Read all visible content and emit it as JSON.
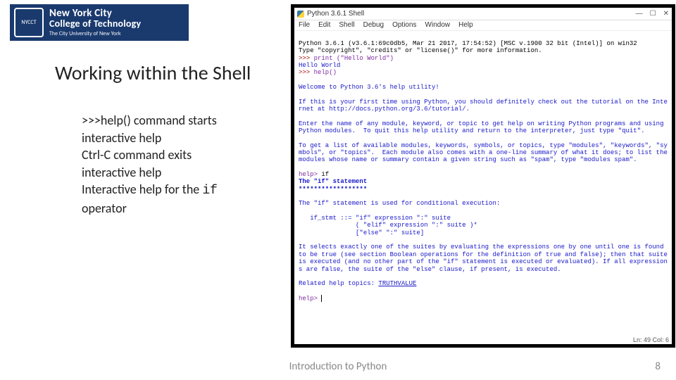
{
  "logo": {
    "line1": "New York City",
    "line2": "College of Technology",
    "line3": "The City University of New York",
    "seal": "NYCCT"
  },
  "slide_title": "Working within the Shell",
  "bullets": {
    "b1a": ">>>help() command starts",
    "b1b": "interactive help",
    "b2a": "Ctrl-C command exits",
    "b2b": "interactive help",
    "b3a": "Interactive help for the ",
    "b3code": "if",
    "b3b": "operator"
  },
  "shell": {
    "title": "Python 3.6.1 Shell",
    "win_min": "—",
    "win_max": "☐",
    "win_close": "✕",
    "menu": [
      "File",
      "Edit",
      "Shell",
      "Debug",
      "Options",
      "Window",
      "Help"
    ],
    "banner1": "Python 3.6.1 (v3.6.1:69c0db5, Mar 21 2017, 17:54:52) [MSC v.1900 32 bit (Intel)] on win32",
    "banner2": "Type \"copyright\", \"credits\" or \"license()\" for more information.",
    "prompt": ">>> ",
    "line_print": "print (\"Hello World\")",
    "out_print": "Hello World",
    "line_help": "help()",
    "help_welcome": "Welcome to Python 3.6's help utility!",
    "help_p1": "If this is your first time using Python, you should definitely check out the tutorial on the Internet at http://docs.python.org/3.6/tutorial/.",
    "help_p2": "Enter the name of any module, keyword, or topic to get help on writing Python programs and using Python modules.  To quit this help utility and return to the interpreter, just type \"quit\".",
    "help_p3": "To get a list of available modules, keywords, symbols, or topics, type \"modules\", \"keywords\", \"symbols\", or \"topics\".  Each module also comes with a one-line summary of what it does; to list the modules whose name or summary contain a given string such as \"spam\", type \"modules spam\".",
    "help_prompt": "help> ",
    "help_input": "if",
    "if_title": "The \"if\" statement",
    "if_sep": "******************",
    "if_desc": "The \"if\" statement is used for conditional execution:",
    "if_syntax1": "   if_stmt ::= \"if\" expression \":\" suite",
    "if_syntax2": "               ( \"elif\" expression \":\" suite )*",
    "if_syntax3": "               [\"else\" \":\" suite]",
    "if_body": "It selects exactly one of the suites by evaluating the expressions one by one until one is found to be true (see section Boolean operations for the definition of true and false); then that suite is executed (and no other part of the \"if\" statement is executed or evaluated). If all expressions are false, the suite of the \"else\" clause, if present, is executed.",
    "if_related": "Related help topics: ",
    "if_related_link": "TRUTHVALUE",
    "status": "Ln: 49  Col: 6"
  },
  "footer": "Introduction to Python",
  "page": "8"
}
